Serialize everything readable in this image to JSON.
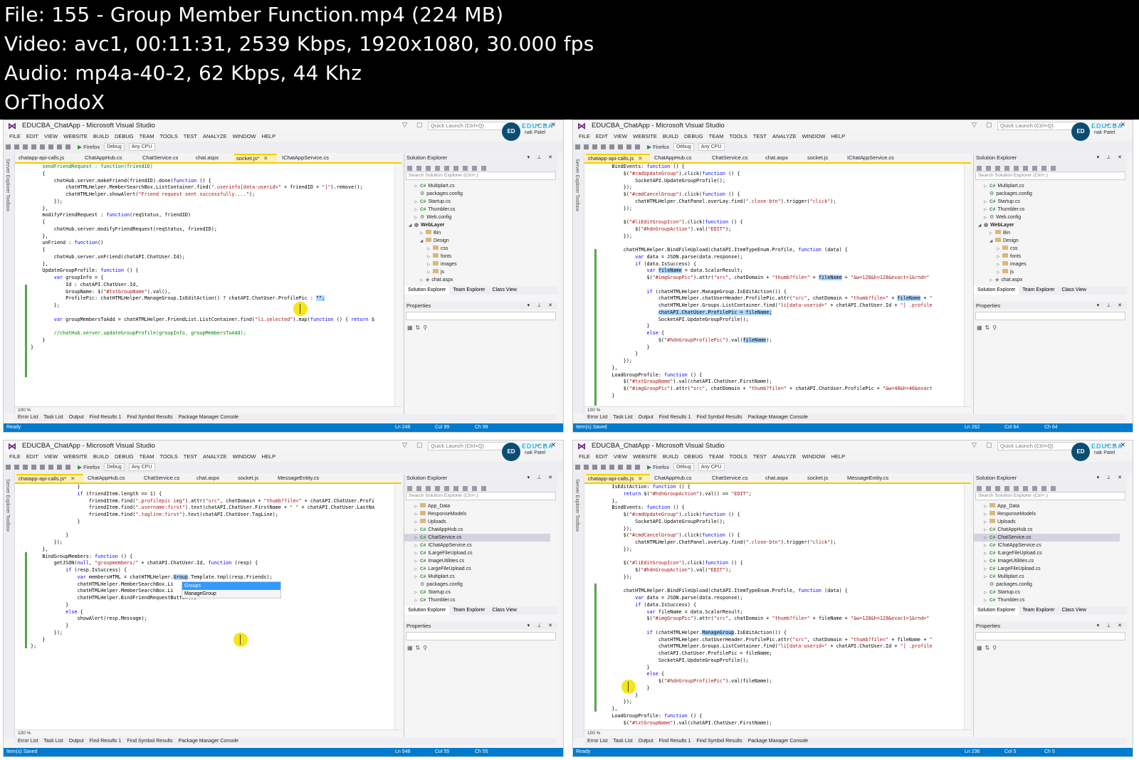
{
  "header": {
    "line1": "File: 155 - Group Member Function.mp4 (224 MB)",
    "line2": "Video: avc1, 00:11:31, 2539 Kbps, 1920x1080, 30.000 fps",
    "line3": "Audio: mp4a-40-2, 62 Kbps, 44 Khz",
    "line4": "OrThodoX"
  },
  "common": {
    "window_title": "EDUCBA_ChatApp - Microsoft Visual Studio",
    "quick_launch": "Quick Launch (Ctrl+Q)",
    "brand": "EDUCBA",
    "user": "nak Patel",
    "menu": [
      "FILE",
      "EDIT",
      "VIEW",
      "WEBSITE",
      "BUILD",
      "DEBUG",
      "TEAM",
      "TOOLS",
      "TEST",
      "ANALYZE",
      "WINDOW",
      "HELP"
    ],
    "toolbar": {
      "browser": "Firefox",
      "config": "Debug",
      "platform": "Any CPU"
    },
    "side_labels": [
      "Server Explorer",
      "Toolbox"
    ],
    "solution_explorer_title": "Solution Explorer",
    "search_solution": "Search Solution Explorer (Ctrl+;)",
    "properties_title": "Properties",
    "panel_tabs": [
      "Solution Explorer",
      "Team Explorer",
      "Class View"
    ],
    "bottom_tabs": [
      "Error List",
      "Task List",
      "Output",
      "Find Results 1",
      "Find Symbol Results",
      "Package Manager Console"
    ],
    "zoom": "100 %"
  },
  "panels": [
    {
      "tabs": [
        "chatapp-api-calls.js",
        "ChatAppHub.cs",
        "ChatService.cs",
        "chat.aspx",
        "socket.js*",
        "IChatAppService.cs"
      ],
      "active_tab": 4,
      "tree": [
        "Multiplart.cs",
        "packages.config",
        "Startup.cs",
        "Thumbler.cs",
        "Web.config",
        "WebLayer",
        "Bin",
        "Design",
        "css",
        "fonts",
        "images",
        "js",
        "chat.aspx"
      ],
      "status": {
        "left": "Ready",
        "ln": "Ln 246",
        "col": "Col 99",
        "ch": "Ch 99"
      }
    },
    {
      "tabs": [
        "chatapp-api-calls.js",
        "ChatAppHub.cs",
        "ChatService.cs",
        "chat.aspx",
        "socket.js",
        "IChatAppService.cs"
      ],
      "active_tab": 0,
      "tree": [
        "Multiplart.cs",
        "packages.config",
        "Startup.cs",
        "Thumbler.cs",
        "Web.config",
        "WebLayer",
        "Bin",
        "Design",
        "css",
        "fonts",
        "images",
        "js",
        "chat.aspx"
      ],
      "status": {
        "left": "Item(s) Saved",
        "ln": "Ln 262",
        "col": "Col 64",
        "ch": "Ch 64"
      }
    },
    {
      "tabs": [
        "chatapp-api-calls.js*",
        "ChatAppHub.cs",
        "ChatService.cs",
        "chat.aspx",
        "socket.js",
        "MessageEntity.cs"
      ],
      "active_tab": 0,
      "tree": [
        "App_Data",
        "ResponseModels",
        "Uploads",
        "ChatAppHub.cs",
        "ChatService.cs",
        "IChatAppService.cs",
        "ILargeFileUpload.cs",
        "ImageUtilities.cs",
        "LargeFileUpload.cs",
        "Multiplart.cs",
        "packages.config",
        "Startup.cs",
        "Thumbler.cs"
      ],
      "intellisense": [
        "Groups",
        "ManageGroup"
      ],
      "status": {
        "left": "Item(s) Saved",
        "ln": "Ln 548",
        "col": "Col 55",
        "ch": "Ch 55"
      }
    },
    {
      "tabs": [
        "chatapp-api-calls.js",
        "ChatAppHub.cs",
        "ChatService.cs",
        "chat.aspx",
        "socket.js",
        "MessageEntity.cs"
      ],
      "active_tab": 0,
      "tree": [
        "App_Data",
        "ResponseModels",
        "Uploads",
        "ChatAppHub.cs",
        "ChatService.cs",
        "IChatAppService.cs",
        "ILargeFileUpload.cs",
        "ImageUtilities.cs",
        "LargeFileUpload.cs",
        "Multiplart.cs",
        "packages.config",
        "Startup.cs",
        "Thumbler.cs"
      ],
      "status": {
        "left": "Ready",
        "ln": "Ln 236",
        "col": "Col 5",
        "ch": "Ch 5"
      }
    }
  ]
}
